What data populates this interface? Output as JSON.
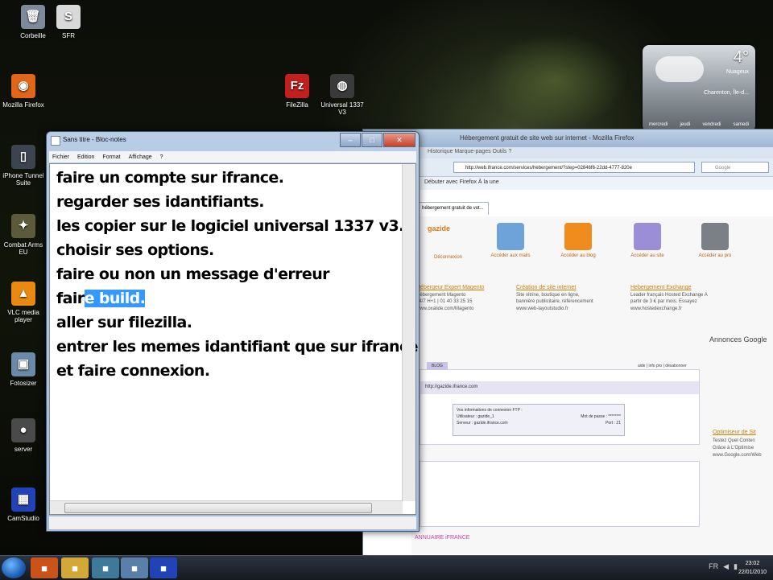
{
  "desktop": {
    "icons": [
      {
        "label": "Corbeille",
        "icon": "recycle-bin-icon",
        "color": "#7d8a99",
        "glyph": "🗑"
      },
      {
        "label": "SFR",
        "icon": "sfr-file-icon",
        "color": "#d9d9d9",
        "glyph": "S"
      },
      {
        "label": "Mozilla Firefox",
        "icon": "firefox-icon",
        "color": "#e2661a",
        "glyph": "◉"
      },
      {
        "label": "iPhone Tunnel Suite",
        "icon": "iphone-icon",
        "color": "#3c4450",
        "glyph": "▯"
      },
      {
        "label": "Combat Arms EU",
        "icon": "combat-arms-icon",
        "color": "#5b5b3c",
        "glyph": "✦"
      },
      {
        "label": "VLC media player",
        "icon": "vlc-icon",
        "color": "#e88a12",
        "glyph": "▲"
      },
      {
        "label": "Fotosizer",
        "icon": "fotosizer-icon",
        "color": "#6b8aa8",
        "glyph": "▣"
      },
      {
        "label": "server",
        "icon": "server-icon",
        "color": "#4a4a4a",
        "glyph": "●"
      },
      {
        "label": "CamStudio",
        "icon": "camstudio-icon",
        "color": "#2243b8",
        "glyph": "▦"
      },
      {
        "label": "FileZilla",
        "icon": "filezilla-icon",
        "color": "#c41f1f",
        "glyph": "Fz"
      },
      {
        "label": "Universal 1337 V3",
        "icon": "universal-1337-icon",
        "color": "#3a3a3a",
        "glyph": "◍"
      }
    ]
  },
  "weather": {
    "temperature": "4°",
    "condition": "Nuageux",
    "location": "Charenton, Île-d...",
    "days": [
      "mercredi",
      "jeudi",
      "vendredi",
      "samedi"
    ]
  },
  "firefox": {
    "title": "Hébergement gratuit de site web sur internet - Mozilla Firefox",
    "menu": "Historique   Marque-pages   Outils   ?",
    "url": "http://web.ifrance.com/services/hebergement/?step=02846f6-22dd-4777-820e",
    "search_placeholder": "Google",
    "bookmarks": "Débuter avec Firefox   À la une",
    "tab_label": "hébergement gratuit de vot...",
    "page": {
      "logo": "gazide",
      "connect": "Déconnexion",
      "quick_links": [
        "Accéder aux mails",
        "Accéder au blog",
        "Accéder au site",
        "Accéder au pro"
      ],
      "ads": [
        {
          "title": "Hébergeur Expert Magento",
          "lines": [
            "Hébergement Magento",
            "24/7 H+1 | 01 40 33 25 15",
            "www.oxalide.com/Magento"
          ]
        },
        {
          "title": "Création de site internet",
          "lines": [
            "Site vitrine, boutique en ligne,",
            "bannière publicitaire, référencement",
            "www.web-layoutstudio.fr"
          ]
        },
        {
          "title": "Hebergement Exchange",
          "lines": [
            "Leader français Hosted Exchange A",
            "partir de 3 € par mois. Essayez",
            "www.hostedexchange.fr"
          ]
        }
      ],
      "google_ads": "Annonces Google",
      "panel_tab": "BLOG",
      "panel_links": "aide | info pro | désabonner",
      "site_url": "http://gazide.ifrance.com",
      "ftp": {
        "heading": "Vos informations de connexion FTP :",
        "user_label": "Utilisateur : gazide_1",
        "password_label": "Mot de passe : ********",
        "server_label": "Serveur : gazide.ifrance.com",
        "port_label": "Port : 21"
      },
      "annuaire": "ANNUAIRE iFRANCE",
      "optimiseur": {
        "title": "Optimiseur de Sit",
        "lines": [
          "Testez Quel Conten",
          "Grâce à L'Optimise",
          "www.Google.com/Web"
        ]
      }
    }
  },
  "notepad": {
    "title": "Sans titre - Bloc-notes",
    "menu": [
      "Fichier",
      "Edition",
      "Format",
      "Affichage",
      "?"
    ],
    "lines": [
      "faire un compte sur ifrance.",
      "regarder ses idantifiants.",
      "les copier sur le logiciel universal 1337 v3.",
      "choisir ses options.",
      "faire ou non un message d'erreur"
    ],
    "line6_plain": "fair",
    "line6_selected": "e build.",
    "lines_after": [
      "aller sur filezilla.",
      "entrer les memes idantifiant que sur ifrance",
      "et faire connexion."
    ],
    "selection_color": "#3399ff"
  },
  "taskbar": {
    "items": [
      {
        "icon": "firefox-icon",
        "color": "#c95318"
      },
      {
        "icon": "explorer-folder-icon",
        "color": "#d4a836"
      },
      {
        "icon": "network-icon",
        "color": "#3d7a9a"
      },
      {
        "icon": "notepad-icon",
        "color": "#5a7fa8"
      },
      {
        "icon": "camstudio-icon",
        "color": "#2243b8"
      }
    ],
    "tray": "FR",
    "time": "23:02",
    "date": "22/01/2010"
  }
}
